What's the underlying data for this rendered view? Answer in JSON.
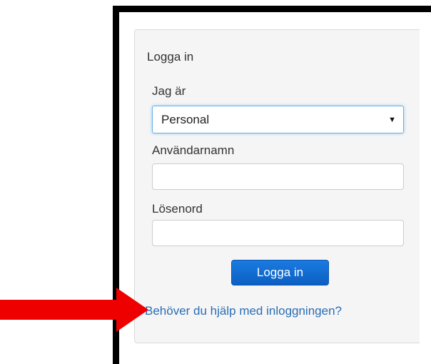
{
  "login": {
    "title": "Logga in",
    "role_label": "Jag är",
    "role_selected": "Personal",
    "username_label": "Användarnamn",
    "username_value": "",
    "password_label": "Lösenord",
    "password_value": "",
    "submit_label": "Logga in",
    "help_link": "Behöver du hjälp med inloggningen?"
  },
  "annotation": {
    "arrow_color": "#ee0000",
    "arrow_icon": "arrow-right-icon"
  }
}
